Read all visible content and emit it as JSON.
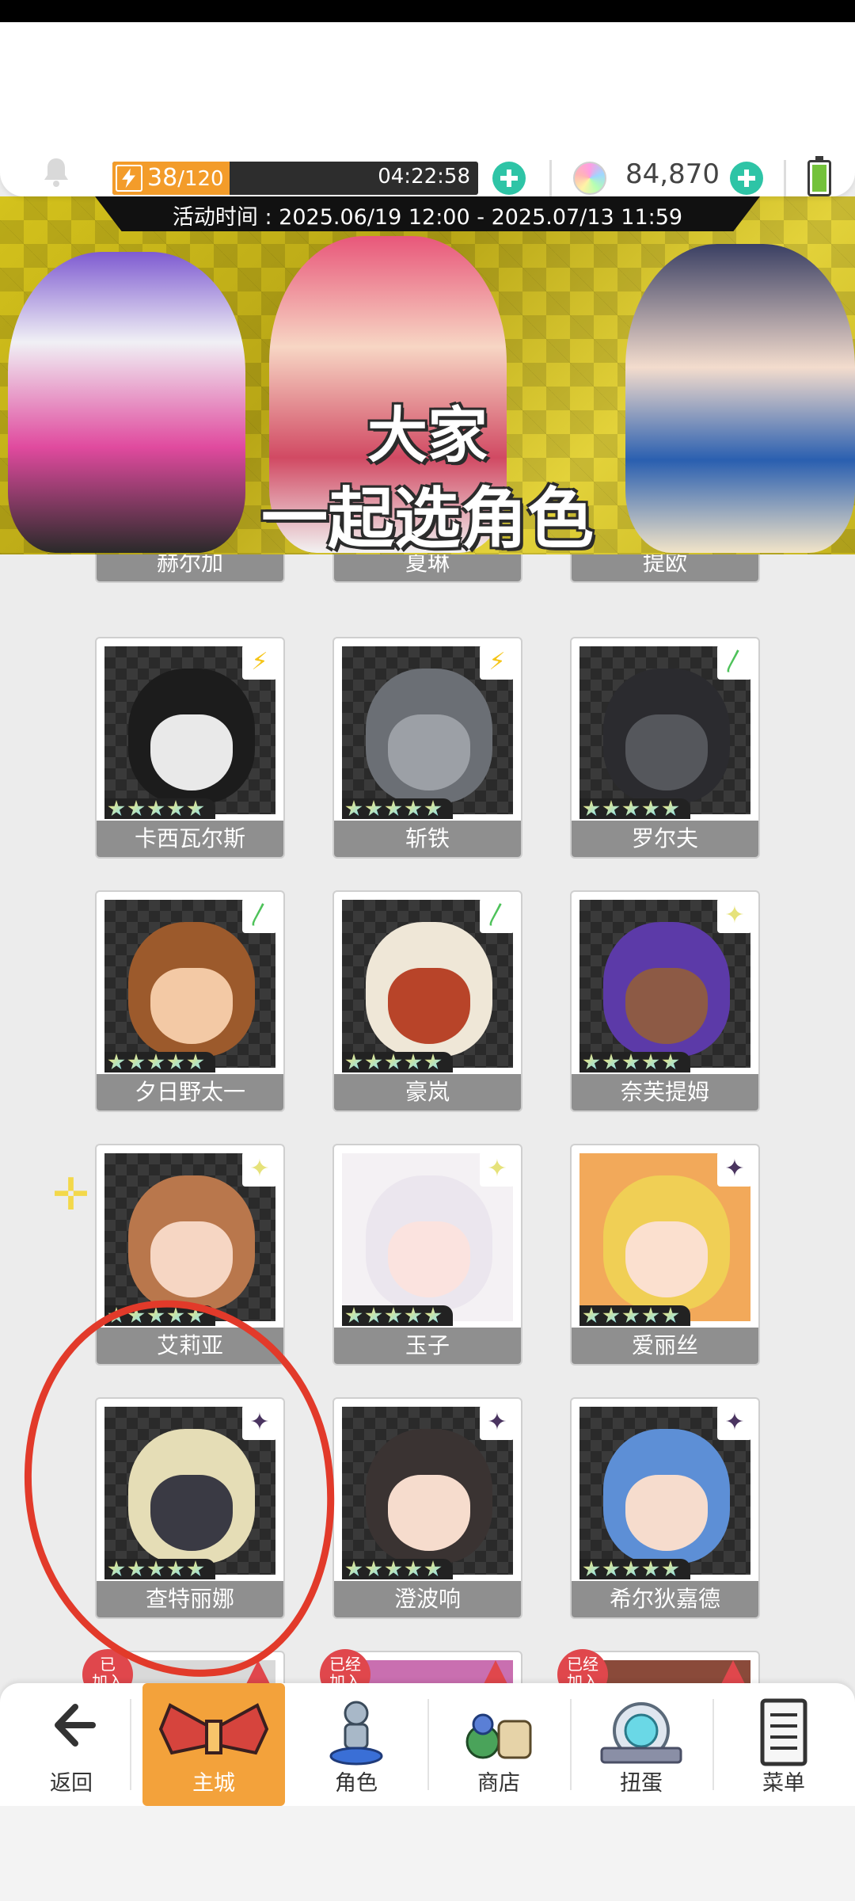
{
  "header": {
    "stamina_current": "38",
    "stamina_max": "/120",
    "stamina_fraction": 0.32,
    "stamina_timer": "04:22:58",
    "gem_count": "84,870"
  },
  "banner": {
    "event_period": "活动时间 : 2025.06/19 12:00 - 2025.07/13 11:59",
    "title_line1": "大家",
    "title_line2": "一起选角色"
  },
  "characters": [
    {
      "name": "赫尔加",
      "element": "none"
    },
    {
      "name": "夏琳",
      "element": "none"
    },
    {
      "name": "提欧",
      "element": "none"
    },
    {
      "name": "卡西瓦尔斯",
      "element": "lightning"
    },
    {
      "name": "斩铁",
      "element": "lightning"
    },
    {
      "name": "罗尔夫",
      "element": "wind"
    },
    {
      "name": "夕日野太一",
      "element": "wind"
    },
    {
      "name": "豪岚",
      "element": "wind"
    },
    {
      "name": "奈芙提姆",
      "element": "light"
    },
    {
      "name": "艾莉亚",
      "element": "light"
    },
    {
      "name": "玉子",
      "element": "light"
    },
    {
      "name": "爱丽丝",
      "element": "dark"
    },
    {
      "name": "查特丽娜",
      "element": "dark"
    },
    {
      "name": "澄波响",
      "element": "dark"
    },
    {
      "name": "希尔狄嘉德",
      "element": "dark"
    }
  ],
  "joined_badge": {
    "left": "已\n加入",
    "others": "已经\n加入"
  },
  "nav": [
    {
      "label": "返回",
      "icon": "back-arrow-icon"
    },
    {
      "label": "主城",
      "icon": "castle-wings-icon"
    },
    {
      "label": "角色",
      "icon": "character-statue-icon"
    },
    {
      "label": "商店",
      "icon": "shop-bag-icon"
    },
    {
      "label": "扭蛋",
      "icon": "gacha-machine-icon"
    },
    {
      "label": "菜单",
      "icon": "menu-list-icon"
    }
  ],
  "colors": {
    "accent_orange": "#f3a23b",
    "plus_green": "#2ec4a6",
    "annotation_red": "#e23a2a"
  }
}
